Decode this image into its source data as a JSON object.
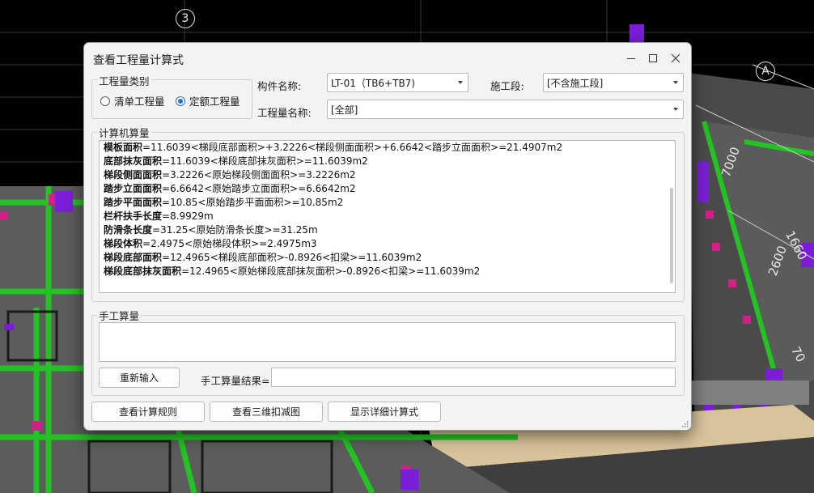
{
  "background": {
    "axis_labels": {
      "top": "3",
      "right": "A"
    },
    "dimensions": [
      "7000",
      "2600",
      "1660",
      "70"
    ]
  },
  "dialog": {
    "title": "查看工程量计算式",
    "controls": {
      "minimize": "minimize-icon",
      "maximize": "maximize-icon",
      "close": "close-icon"
    },
    "quantity_type": {
      "legend": "工程量类别",
      "options": [
        {
          "label": "清单工程量",
          "checked": false
        },
        {
          "label": "定额工程量",
          "checked": true
        }
      ]
    },
    "component_name": {
      "label": "构件名称:",
      "value": "LT-01（TB6+TB7)"
    },
    "construction_section": {
      "label": "施工段:",
      "value": "[不含施工段]"
    },
    "quantity_name": {
      "label": "工程量名称:",
      "value": "[全部]"
    },
    "computer_calc": {
      "legend": "计算机算量",
      "lines": [
        {
          "name": "模板面积",
          "expr": "=11.6039<梯段底部面积>+3.2226<梯段侧面面积>+6.6642<踏步立面面积>=21.4907m2"
        },
        {
          "name": "底部抹灰面积",
          "expr": "=11.6039<梯段底部抹灰面积>=11.6039m2"
        },
        {
          "name": "梯段侧面面积",
          "expr": "=3.2226<原始梯段侧面面积>=3.2226m2"
        },
        {
          "name": "踏步立面面积",
          "expr": "=6.6642<原始踏步立面面积>=6.6642m2"
        },
        {
          "name": "踏步平面面积",
          "expr": "=10.85<原始踏步平面面积>=10.85m2"
        },
        {
          "name": "栏杆扶手长度",
          "expr": "=8.9929m"
        },
        {
          "name": "防滑条长度",
          "expr": "=31.25<原始防滑条长度>=31.25m"
        },
        {
          "name": "梯段体积",
          "expr": "=2.4975<原始梯段体积>=2.4975m3"
        },
        {
          "name": "梯段底部面积",
          "expr": "=12.4965<梯段底部面积>-0.8926<扣梁>=11.6039m2"
        },
        {
          "name": "梯段底部抹灰面积",
          "expr": "=12.4965<原始梯段底部抹灰面积>-0.8926<扣梁>=11.6039m2"
        }
      ]
    },
    "manual_calc": {
      "legend": "手工算量",
      "reenter_button": "重新输入",
      "result_label": "手工算量结果=",
      "result_value": ""
    },
    "footer_buttons": {
      "view_rules": "查看计算规则",
      "view_3d": "查看三维扣减图",
      "show_detail": "显示详细计算式"
    }
  }
}
